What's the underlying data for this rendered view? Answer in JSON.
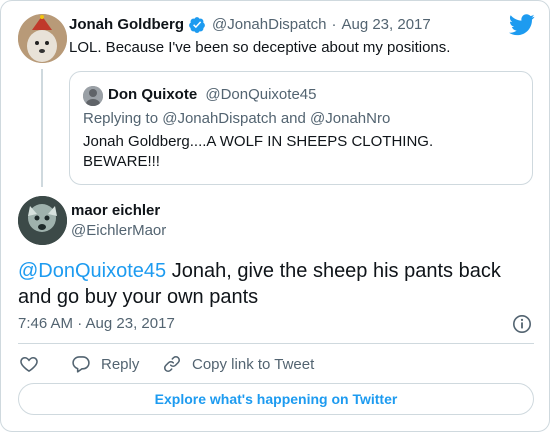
{
  "parent_tweet": {
    "author_name": "Jonah Goldberg",
    "handle": "@JonahDispatch",
    "separator": "·",
    "date": "Aug 23, 2017",
    "text": "LOL. Because I've been so deceptive about my positions."
  },
  "quoted_tweet": {
    "author_name": "Don Quixote",
    "handle": "@DonQuixote45",
    "replying_to": "Replying to @JonahDispatch and @JonahNro",
    "text": "Jonah Goldberg....A WOLF IN SHEEPS CLOTHING. BEWARE!!!"
  },
  "main_tweet": {
    "author_name": "maor eichler",
    "handle": "@EichlerMaor",
    "mention": "@DonQuixote45",
    "text": " Jonah, give the sheep his pants back and go buy your own pants",
    "timestamp": "7:46 AM · Aug 23, 2017"
  },
  "actions": {
    "reply_label": "Reply",
    "copy_label": "Copy link to Tweet"
  },
  "footer": {
    "explore_label": "Explore what's happening on Twitter"
  },
  "colors": {
    "accent": "#1d9bf0",
    "muted": "#536471",
    "border": "#cfd9de"
  },
  "icons": [
    "verified-badge-icon",
    "twitter-bird-icon",
    "info-icon",
    "heart-icon",
    "reply-bubble-icon",
    "link-icon"
  ]
}
